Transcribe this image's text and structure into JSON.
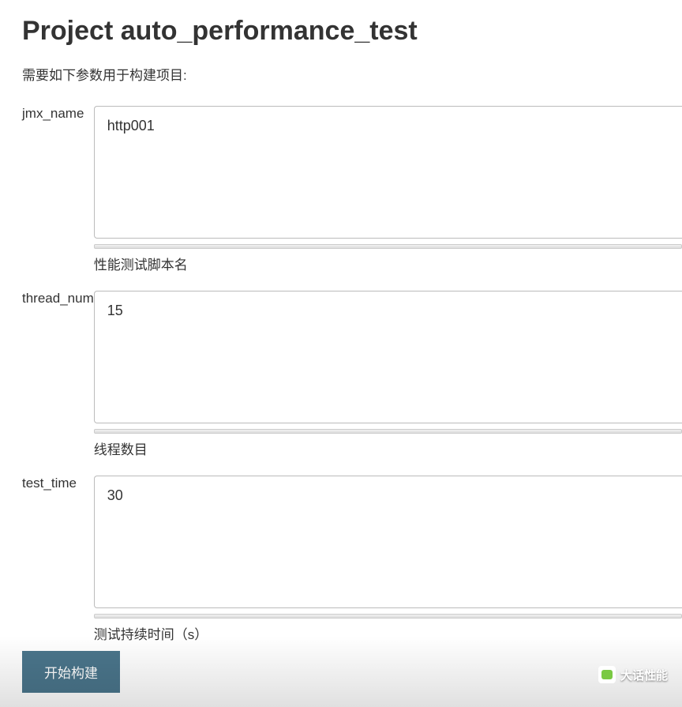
{
  "page": {
    "title": "Project auto_performance_test",
    "description": "需要如下参数用于构建项目:"
  },
  "form": {
    "fields": [
      {
        "name": "jmx_name",
        "value": "http001",
        "help": "性能测试脚本名"
      },
      {
        "name": "thread_num",
        "value": "15",
        "help": "线程数目"
      },
      {
        "name": "test_time",
        "value": "30",
        "help": "测试持续时间（s）"
      }
    ],
    "submit_label": "开始构建"
  },
  "watermark": {
    "text": "大话性能"
  }
}
